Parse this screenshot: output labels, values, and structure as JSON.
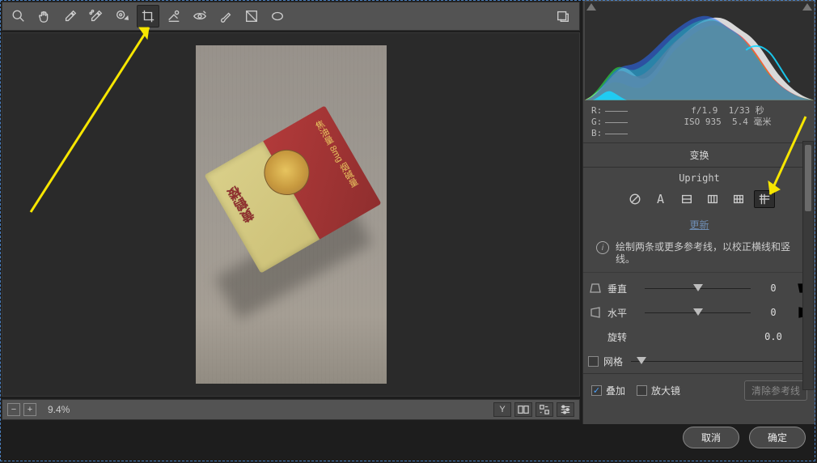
{
  "toolbar": {
    "tools": [
      "zoom",
      "hand",
      "white-balance",
      "color-sampler",
      "target-adjust",
      "crop",
      "spot-removal",
      "redeye",
      "brush",
      "gradient",
      "radial"
    ],
    "selected": "crop"
  },
  "status": {
    "zoom": "9.4%"
  },
  "info": {
    "r_label": "R:",
    "g_label": "G:",
    "b_label": "B:",
    "aperture": "f/1.9",
    "shutter": "1/33 秒",
    "iso": "ISO 935",
    "focal": "5.4 毫米"
  },
  "panel": {
    "transform_title": "变换",
    "upright_label": "Upright",
    "update_link": "更新",
    "hint": "绘制两条或更多参考线，以校正横线和竖线。",
    "sliders": {
      "vertical": {
        "label": "垂直",
        "value": "0"
      },
      "horizontal": {
        "label": "水平",
        "value": "0"
      },
      "rotate": {
        "label": "旋转",
        "value": "0.0"
      },
      "grid": {
        "label": "网格"
      }
    },
    "checks": {
      "overlay": "叠加",
      "loupe": "放大镜"
    },
    "clear_guides": "清除参考线"
  },
  "buttons": {
    "cancel": "取消",
    "ok": "确定"
  },
  "photo": {
    "brand_vert": "黄鹤楼",
    "side_text": "焦油量 8mg 烟碱量"
  }
}
